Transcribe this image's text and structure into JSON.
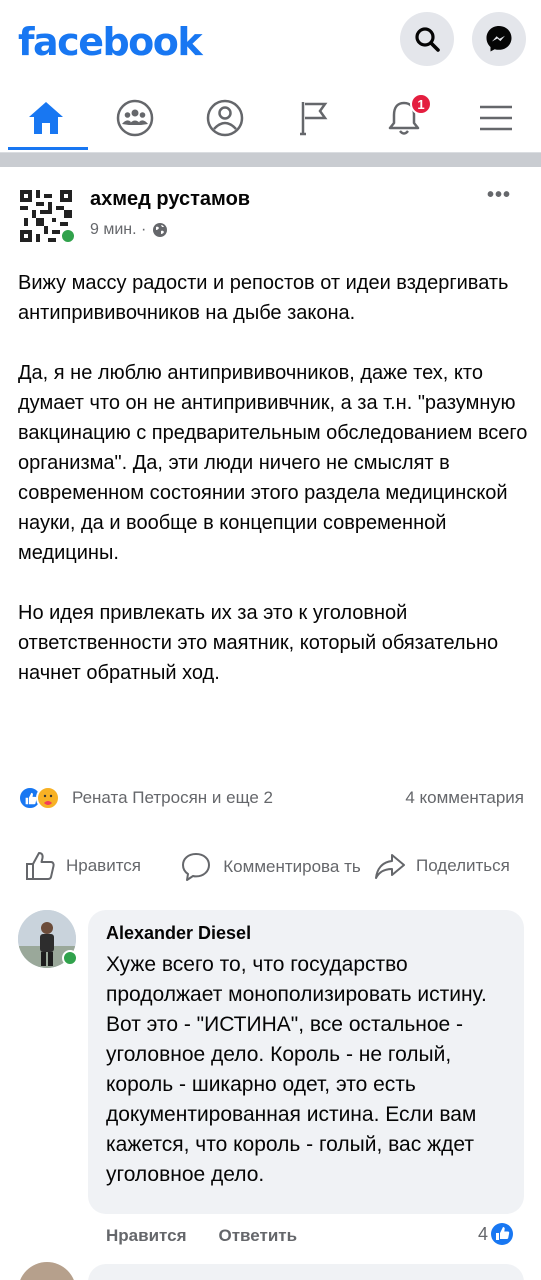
{
  "header": {
    "logo": "facebook",
    "brand_color": "#1877f2",
    "search_icon": "search-icon",
    "messenger_icon": "messenger-icon"
  },
  "nav": {
    "tabs": [
      {
        "name": "home",
        "icon": "home-icon",
        "active": true
      },
      {
        "name": "groups",
        "icon": "groups-icon",
        "active": false
      },
      {
        "name": "profile",
        "icon": "profile-icon",
        "active": false
      },
      {
        "name": "pages",
        "icon": "flag-icon",
        "active": false
      },
      {
        "name": "notifications",
        "icon": "bell-icon",
        "active": false
      },
      {
        "name": "menu",
        "icon": "hamburger-icon",
        "active": false
      }
    ],
    "notification_badge": "1"
  },
  "post": {
    "author": "ахмед рустамов",
    "time": "9 мин. ·",
    "privacy_icon": "globe-icon",
    "more": "•••",
    "paragraphs": [
      "Вижу массу радости и репостов от идеи вздергивать антипрививочников на дыбе закона.",
      "Да, я не люблю антипрививочников, даже тех, кто думает что он не антипрививчник, а за т.н. \"разумную вакцинацию с предварительным обследованием всего организма\". Да, эти люди ничего не смыслят в современном состоянии этого раздела медицинской науки, да и вообще в концепции современной медицины.",
      "Но идея привлекать их за это к уголовной ответственности это маятник, который обязательно начнет обратный ход."
    ],
    "reactions_text": "Рената Петросян и еще 2",
    "comments_count": "4 комментария",
    "actions": {
      "like": "Нравится",
      "comment": "Комментирова ть",
      "share": "Поделиться"
    }
  },
  "comment": {
    "author": "Alexander Diesel",
    "text": "Хуже всего то, что государство продолжает монополизировать истину. Вот это - \"ИСТИНА\", все остальное - уголовное дело. Король - не голый, король - шикарно одет, это есть документированная истина. Если вам кажется, что король - голый, вас ждет уголовное дело.",
    "like_label": "Нравится",
    "reply_label": "Ответить",
    "reaction_count": "4"
  },
  "colors": {
    "accent": "#1877f2",
    "online": "#31a24c",
    "badge": "#e41e3f",
    "secondary_text": "#65676b",
    "bubble": "#f0f2f5"
  }
}
